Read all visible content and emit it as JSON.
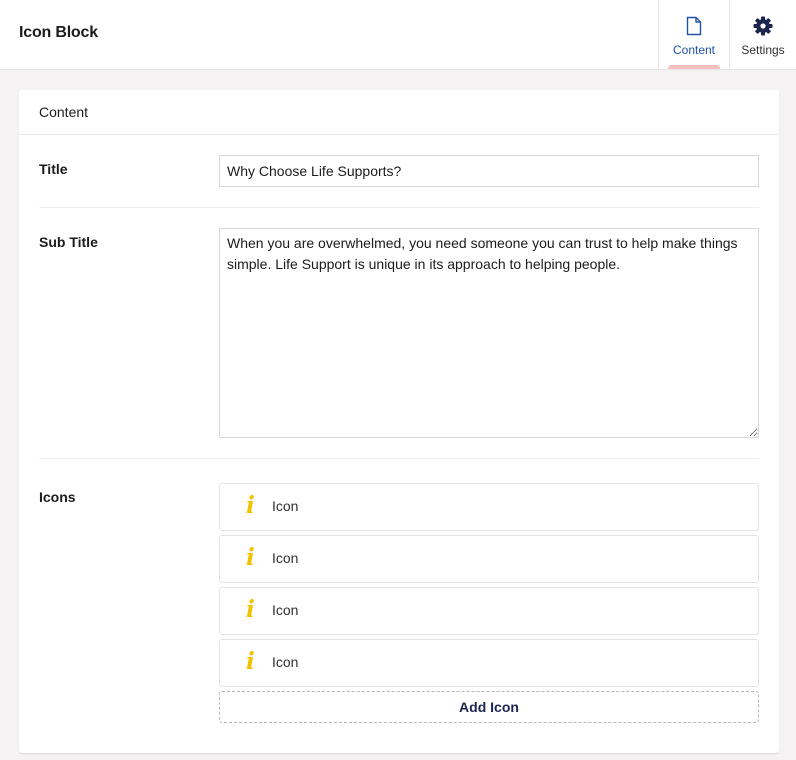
{
  "header": {
    "title": "Icon Block",
    "tabs": [
      {
        "label": "Content",
        "icon": "document-icon",
        "active": true
      },
      {
        "label": "Settings",
        "icon": "gear-icon",
        "active": false
      }
    ]
  },
  "panel": {
    "heading": "Content",
    "title_field": {
      "label": "Title",
      "value": "Why Choose Life Supports?"
    },
    "subtitle_field": {
      "label": "Sub Title",
      "value": "When you are overwhelmed, you need someone you can trust to help make things simple. Life Support is unique in its approach to helping people."
    },
    "icons_field": {
      "label": "Icons",
      "items": [
        {
          "name": "Icon",
          "icon": "info-icon"
        },
        {
          "name": "Icon",
          "icon": "info-icon"
        },
        {
          "name": "Icon",
          "icon": "info-icon"
        },
        {
          "name": "Icon",
          "icon": "info-icon"
        }
      ],
      "add_label": "Add Icon"
    }
  },
  "colors": {
    "accent": "#2152a3",
    "tab_indicator": "#f5c1bc",
    "icon_yellow": "#f2c200",
    "background": "#f4f2f2"
  }
}
